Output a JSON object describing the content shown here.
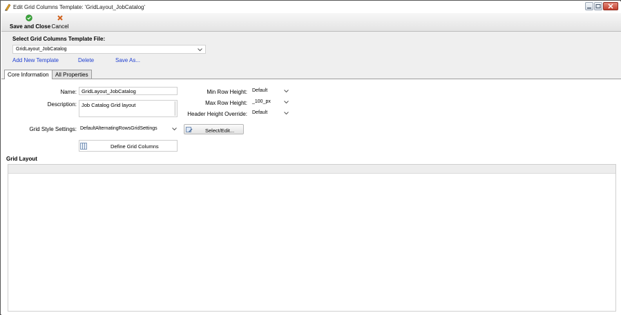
{
  "window": {
    "title": "Edit Grid Columns Template: 'GridLayout_JobCatalog'"
  },
  "toolbar": {
    "save_label": "Save and Close",
    "cancel_label": "Cancel"
  },
  "template_select": {
    "label": "Select Grid Columns Template File:",
    "value": "GridLayout_JobCatalog",
    "links": {
      "add": "Add New Template",
      "delete": "Delete",
      "save_as": "Save As..."
    }
  },
  "tabs": [
    {
      "label": "Core Information",
      "active": true
    },
    {
      "label": "All Properties",
      "active": false
    }
  ],
  "form": {
    "name_label": "Name:",
    "name_value": "GridLayout_JobCatalog",
    "description_label": "Description:",
    "description_value": "Job Catalog Grid layout",
    "min_row_label": "Min Row Height:",
    "min_row_value": "Default",
    "max_row_label": "Max Row Height:",
    "max_row_value": "_100_px",
    "header_height_label": "Header Height Override:",
    "header_height_value": "Default",
    "grid_style_label": "Grid Style Settings:",
    "grid_style_value": "DefaultAlternatingRowsGridSettings",
    "select_edit_label": "Select/Edit...",
    "define_columns_label": "Define Grid Columns"
  },
  "grid_layout": {
    "label": "Grid Layout"
  },
  "colors": {
    "link": "#1f3fd1",
    "save_icon": "#3aa53a",
    "cancel_icon": "#d0611c"
  },
  "icons": {
    "title": "pencil-icon",
    "save": "check-circle-icon",
    "cancel": "x-icon",
    "select_edit": "edit-settings-icon",
    "define_columns": "columns-icon"
  }
}
